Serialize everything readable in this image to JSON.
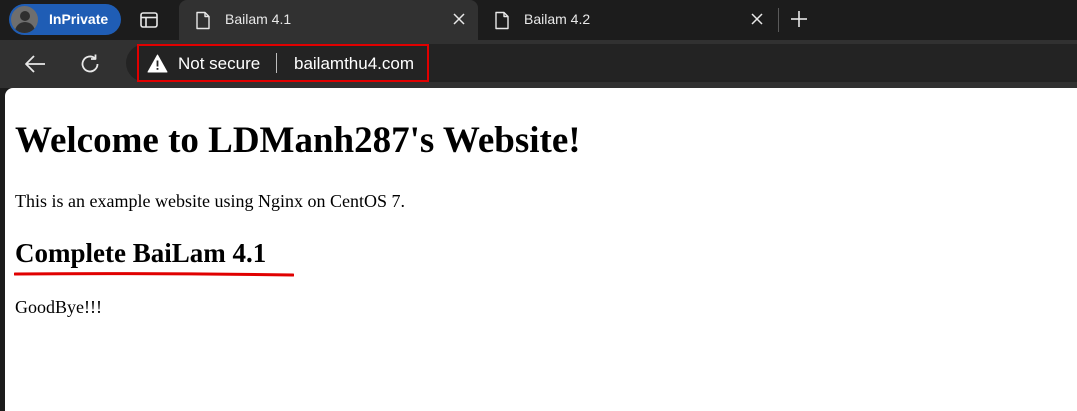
{
  "browser": {
    "inprivate_label": "InPrivate",
    "tabs": [
      {
        "title": "Bailam 4.1",
        "active": true
      },
      {
        "title": "Bailam 4.2",
        "active": false
      }
    ],
    "address": {
      "security_text": "Not secure",
      "url": "bailamthu4.com"
    },
    "icons": {
      "tab_actions": "tab-actions-icon",
      "back": "back-arrow-icon",
      "refresh": "refresh-icon",
      "warning": "warning-icon",
      "new_tab": "plus-icon",
      "close": "close-icon",
      "document": "document-icon"
    }
  },
  "page": {
    "heading": "Welcome to LDManh287's Website!",
    "intro": "This is an example website using Nginx on CentOS 7.",
    "subheading": "Complete BaiLam 4.1",
    "closing": "GoodBye!!!"
  },
  "colors": {
    "highlight_box": "#e00000",
    "underline": "#e00000",
    "inprivate_badge": "#1f5db5"
  }
}
